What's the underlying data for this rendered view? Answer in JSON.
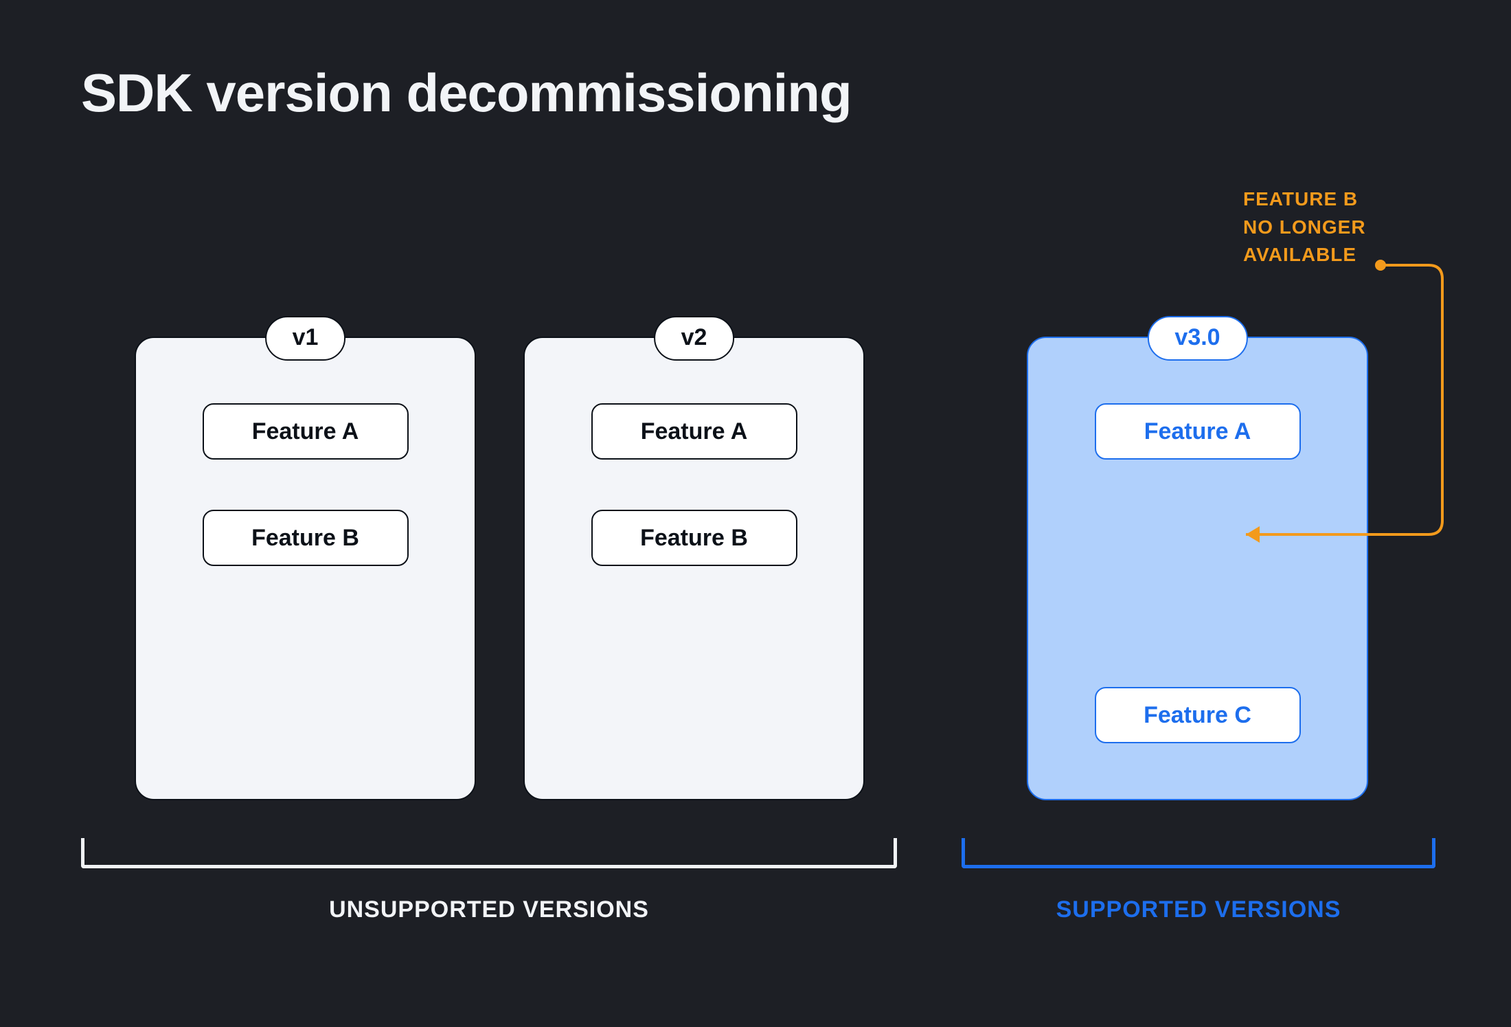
{
  "title": "SDK version decommissioning",
  "unsupported": {
    "label": "UNSUPPORTED VERSIONS",
    "cards": [
      {
        "version": "v1",
        "features": [
          "Feature A",
          "Feature B"
        ]
      },
      {
        "version": "v2",
        "features": [
          "Feature A",
          "Feature B"
        ]
      }
    ]
  },
  "supported": {
    "label": "SUPPORTED VERSIONS",
    "cards": [
      {
        "version": "v3.0",
        "features": [
          "Feature A",
          "Feature C"
        ]
      }
    ]
  },
  "callout": {
    "line1": "FEATURE B",
    "line2": "NO LONGER",
    "line3": "AVAILABLE"
  },
  "colors": {
    "bg": "#1d1f25",
    "dark": "#0c1118",
    "light_card": "#f3f5f9",
    "blue_card": "#b0d0fc",
    "blue": "#1d6eed",
    "orange": "#f39a1c",
    "white": "#f2f4f7"
  }
}
